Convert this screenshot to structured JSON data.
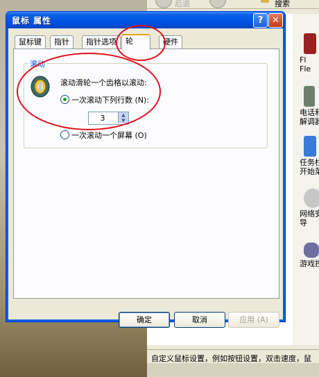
{
  "dialog": {
    "title": "鼠标 属性",
    "help_glyph": "?",
    "close_glyph": "✕",
    "tabs": [
      "鼠标键",
      "指针",
      "指针选项",
      "轮",
      "硬件"
    ],
    "active_tab_index": 3,
    "group_title": "滚动",
    "wheel_description": "滚动滑轮一个齿格以滚动:",
    "option_lines": "一次滚动下列行数 (N):",
    "lines_value": "3",
    "option_screen": "一次滚动一个屏幕 (O)",
    "selected_option": "lines",
    "buttons": {
      "ok": "确定",
      "cancel": "取消",
      "apply": "应用 (A)"
    }
  },
  "background": {
    "toolbar": {
      "back_label": "后退",
      "search_label": "搜索"
    },
    "control_panel_items": [
      "Fl\nFle",
      "电话和\n解调器",
      "任务栏\n开始菜",
      "网络安\n导",
      "游戏控"
    ],
    "status_text": "自定义鼠标设置，例如按钮设置，双击速度，鼠"
  },
  "colors": {
    "titlebar": "#0054e3",
    "tab_highlight": "#e6a31a",
    "annotation": "#e0101a"
  }
}
